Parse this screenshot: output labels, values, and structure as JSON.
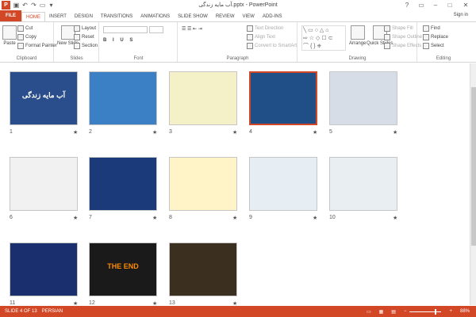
{
  "window": {
    "title": "آب مایه زندگی.pptx - PowerPoint",
    "sign_in": "Sign in"
  },
  "tabs": [
    "FILE",
    "HOME",
    "INSERT",
    "DESIGN",
    "TRANSITIONS",
    "ANIMATIONS",
    "SLIDE SHOW",
    "REVIEW",
    "VIEW",
    "ADD-INS"
  ],
  "ribbon": {
    "clipboard": {
      "label": "Clipboard",
      "paste": "Paste",
      "cut": "Cut",
      "copy": "Copy",
      "format_painter": "Format Painter"
    },
    "slides": {
      "label": "Slides",
      "new_slide": "New Slide",
      "layout": "Layout",
      "reset": "Reset",
      "section": "Section"
    },
    "font": {
      "label": "Font"
    },
    "paragraph": {
      "label": "Paragraph",
      "text_direction": "Text Direction",
      "align_text": "Align Text",
      "convert": "Convert to SmartArt"
    },
    "drawing": {
      "label": "Drawing",
      "arrange": "Arrange",
      "quick_styles": "Quick Styles",
      "shape_fill": "Shape Fill",
      "shape_outline": "Shape Outline",
      "shape_effects": "Shape Effects"
    },
    "editing": {
      "label": "Editing",
      "find": "Find",
      "replace": "Replace",
      "select": "Select"
    }
  },
  "slides": [
    {
      "num": "1",
      "title": "آب مایه زندگی",
      "bg": "#2a4e8c",
      "fg": "#ffffff"
    },
    {
      "num": "2",
      "title": "",
      "bg": "#3b7fc4",
      "fg": "#ffffff"
    },
    {
      "num": "3",
      "title": "",
      "bg": "#f4f0c8",
      "fg": "#333333"
    },
    {
      "num": "4",
      "title": "",
      "bg": "#1f4f86",
      "fg": "#ffffff"
    },
    {
      "num": "5",
      "title": "",
      "bg": "#d6dde6",
      "fg": "#333333"
    },
    {
      "num": "6",
      "title": "",
      "bg": "#f1f1f1",
      "fg": "#333333"
    },
    {
      "num": "7",
      "title": "",
      "bg": "#1a3a7a",
      "fg": "#ffffff"
    },
    {
      "num": "8",
      "title": "",
      "bg": "#fff4c8",
      "fg": "#333333"
    },
    {
      "num": "9",
      "title": "",
      "bg": "#e6edf3",
      "fg": "#333333"
    },
    {
      "num": "10",
      "title": "",
      "bg": "#e9eef2",
      "fg": "#333333"
    },
    {
      "num": "11",
      "title": "",
      "bg": "#1a2f6e",
      "fg": "#ffffff"
    },
    {
      "num": "12",
      "title": "THE END",
      "bg": "#1a1a1a",
      "fg": "#ff8a00"
    },
    {
      "num": "13",
      "title": "",
      "bg": "#3b2f1f",
      "fg": "#dcb46a"
    }
  ],
  "status": {
    "slide_info": "SLIDE 4 OF 13",
    "language": "PERSIAN",
    "zoom": "88%"
  },
  "colors": {
    "accent": "#d24726"
  }
}
